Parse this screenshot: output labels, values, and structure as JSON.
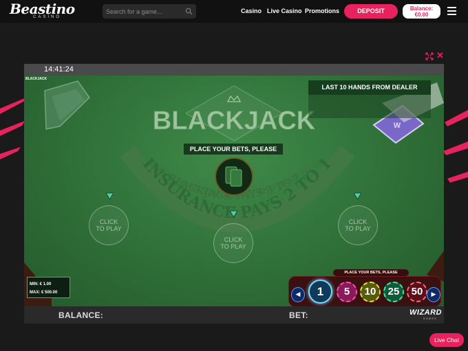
{
  "header": {
    "logo_text": "Beastino",
    "logo_sub": "CASINO",
    "search_placeholder": "Search for a game...",
    "nav": [
      "Casino",
      "Live Casino",
      "Promotions"
    ],
    "deposit_label": "DEPOSIT",
    "balance_label": "Balance:",
    "balance_value": "€0.00"
  },
  "game": {
    "clock": "14:41:24",
    "game_name": "BLACKJACK",
    "table_title": "BLACKJACK",
    "table_line1": "BLACKJACK PAYS 3 TO 2",
    "table_line2": "DEALER MUST STAND ON 17 AND DRAW TO 16",
    "insurance": "INSURANCE PAYS 2 TO 1",
    "last_hands_title": "LAST 10 HANDS FROM DEALER",
    "bets_banner": "PLACE YOUR BETS, PLEASE",
    "spots": [
      "CLICK TO PLAY",
      "CLICK TO PLAY",
      "CLICK TO PLAY"
    ],
    "limits": {
      "min": "MIN: € 1.00",
      "max": "MAX: € 500.00"
    },
    "chip_label": "PLACE YOUR BETS, PLEASE",
    "chips": [
      "1",
      "5",
      "10",
      "25",
      "50"
    ],
    "balance_label": "BALANCE:",
    "bet_label": "BET:",
    "provider": "WIZARD",
    "provider_sub": "GAMES"
  },
  "colors": {
    "accent": "#e8225e",
    "felt": "#2f6b38"
  },
  "live_chat_label": "Live Chat"
}
